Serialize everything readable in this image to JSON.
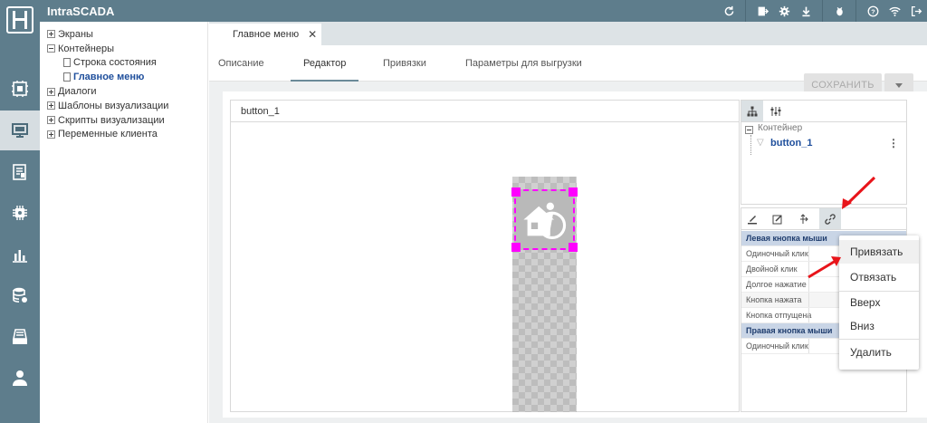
{
  "app": {
    "title": "IntraSCADA"
  },
  "top_icons": [
    "refresh-icon",
    "export-icon",
    "gear-icon",
    "download-icon",
    "bug-icon",
    "help-icon",
    "wifi-icon",
    "logout-icon"
  ],
  "rail": {
    "items": [
      "dashboard-icon",
      "monitor-icon",
      "report-icon",
      "module-icon",
      "chart-icon",
      "database-icon",
      "archive-icon",
      "user-icon"
    ],
    "active_index": 1
  },
  "tree": {
    "items": [
      {
        "label": "Экраны",
        "type": "plus"
      },
      {
        "label": "Контейнеры",
        "type": "minus"
      },
      {
        "label": "Строка состояния",
        "type": "doc"
      },
      {
        "label": "Главное меню",
        "type": "doc",
        "selected": true
      },
      {
        "label": "Диалоги",
        "type": "plus"
      },
      {
        "label": "Шаблоны визуализации",
        "type": "plus"
      },
      {
        "label": "Скрипты визуализации",
        "type": "plus"
      },
      {
        "label": "Переменные клиента",
        "type": "plus"
      }
    ]
  },
  "doc_tab": {
    "label": "Главное меню",
    "close": "✕"
  },
  "subnav": {
    "tabs": [
      "Описание",
      "Редактор",
      "Привязки",
      "Параметры для выгрузки"
    ],
    "active": "Редактор"
  },
  "toolbar": {
    "save_label": "СОХРАНИТЬ"
  },
  "canvas": {
    "title": "button_1"
  },
  "object_tree": {
    "container_label": "Контейнер",
    "child_label": "button_1"
  },
  "properties": {
    "rows": [
      {
        "label": "Левая кнопка мыши",
        "group": true
      },
      {
        "label": "Одиночный клик",
        "group": false
      },
      {
        "label": "Двойной клик",
        "group": false
      },
      {
        "label": "Долгое нажатие",
        "group": false
      },
      {
        "label": "Кнопка нажата",
        "group": false
      },
      {
        "label": "Кнопка отпущена",
        "group": false
      },
      {
        "label": "Правая кнопка мыши",
        "group": true
      },
      {
        "label": "Одиночный клик",
        "group": false
      }
    ]
  },
  "context_menu": {
    "items": [
      "Привязать",
      "Отвязать",
      "Вверх",
      "Вниз",
      "Удалить"
    ]
  },
  "colors": {
    "topbar": "#5e7d8c",
    "selection": "#ff00ff",
    "annotation_arrow": "#e8141a",
    "tree_selected": "#1f4f9c"
  }
}
